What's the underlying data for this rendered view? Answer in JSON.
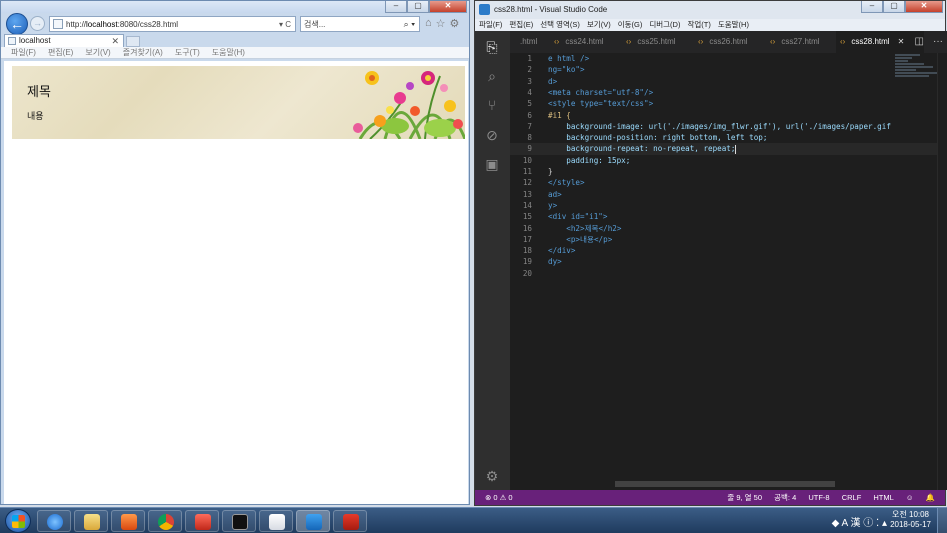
{
  "ie": {
    "url_prefix": "http://",
    "url_host": "localhost",
    "url_rest": ":8080/css28.html",
    "addr_tools": "▾ C",
    "search_placeholder": "검색...",
    "search_icon": "⌕ ▾",
    "tab_label": "localhost",
    "tab_close": "✕",
    "menu": [
      "파일(F)",
      "편집(E)",
      "보기(V)",
      "즐겨찾기(A)",
      "도구(T)",
      "도움말(H)"
    ],
    "page": {
      "heading": "제목",
      "paragraph": "내용"
    }
  },
  "vscode": {
    "title": "css28.html - Visual Studio Code",
    "menu": [
      "파일(F)",
      "편집(E)",
      "선택 영역(S)",
      "보기(V)",
      "이동(G)",
      "디버그(D)",
      "작업(T)",
      "도움말(H)"
    ],
    "tabs": [
      {
        "label": ".html",
        "chev": ""
      },
      {
        "label": "css24.html",
        "chev": "‹›"
      },
      {
        "label": "css25.html",
        "chev": "‹›"
      },
      {
        "label": "css26.html",
        "chev": "‹›"
      },
      {
        "label": "css27.html",
        "chev": "‹›"
      },
      {
        "label": "css28.html",
        "chev": "‹›",
        "close": "✕"
      }
    ],
    "tab_actions": [
      "◫",
      "···"
    ],
    "lines": [
      {
        "n": "1",
        "code": "e html />"
      },
      {
        "n": "2",
        "code": "ng=\"ko\">"
      },
      {
        "n": "3",
        "code": "d>"
      },
      {
        "n": "4",
        "code": "<meta charset=\"utf-8\"/>"
      },
      {
        "n": "5",
        "code": "<style type=\"text/css\">"
      },
      {
        "n": "6",
        "code": "#i1 {"
      },
      {
        "n": "7",
        "code": "    background-image: url('./images/img_flwr.gif'), url('./images/paper.gif"
      },
      {
        "n": "8",
        "code": "    background-position: right bottom, left top;"
      },
      {
        "n": "9",
        "code": "    background-repeat: no-repeat, repeat;"
      },
      {
        "n": "10",
        "code": "    padding: 15px;"
      },
      {
        "n": "11",
        "code": "}"
      },
      {
        "n": "12",
        "code": "</style>"
      },
      {
        "n": "13",
        "code": "ad>"
      },
      {
        "n": "14",
        "code": "y>"
      },
      {
        "n": "15",
        "code": "<div id=\"i1\">"
      },
      {
        "n": "16",
        "code": "    <h2>제목</h2>"
      },
      {
        "n": "17",
        "code": "    <p>내용</p>"
      },
      {
        "n": "18",
        "code": "</div>"
      },
      {
        "n": "19",
        "code": "dy>"
      },
      {
        "n": "20",
        "code": ""
      }
    ],
    "status_left": "⊗ 0  ⚠ 0",
    "status_right": [
      "줄 9, 열 50",
      "공백: 4",
      "UTF-8",
      "CRLF",
      "HTML",
      "☺",
      "🔔"
    ]
  },
  "taskbar": {
    "tray": "◆ A 漢 ⓘ ⁚ ▴",
    "time": "오전 10:08",
    "date": "2018-05-17"
  },
  "colors": {
    "vscode_status": "#68217a",
    "ie_back": "#1e5fb8"
  }
}
